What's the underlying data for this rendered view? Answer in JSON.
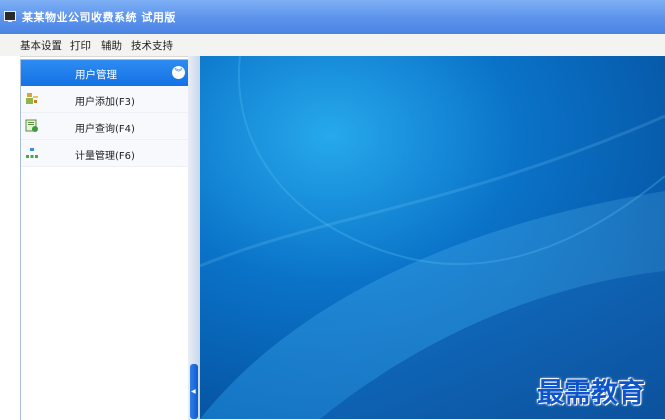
{
  "window": {
    "title": "某某物业公司收费系统 试用版"
  },
  "menu": [
    {
      "label": "基本设置"
    },
    {
      "label": "打印"
    },
    {
      "label": "辅助"
    },
    {
      "label": "技术支持"
    }
  ],
  "sidebar": {
    "header": "用户管理",
    "items": [
      {
        "label": "用户添加(F3)",
        "icon": "user-add-icon"
      },
      {
        "label": "用户查询(F4)",
        "icon": "user-search-icon"
      },
      {
        "label": "计量管理(F6)",
        "icon": "meter-management-icon"
      }
    ]
  },
  "watermark": "最需教育",
  "colors": {
    "titlebar": "#5b93ec",
    "panel_header": "#1572e6",
    "desktop": "#0860b4"
  }
}
